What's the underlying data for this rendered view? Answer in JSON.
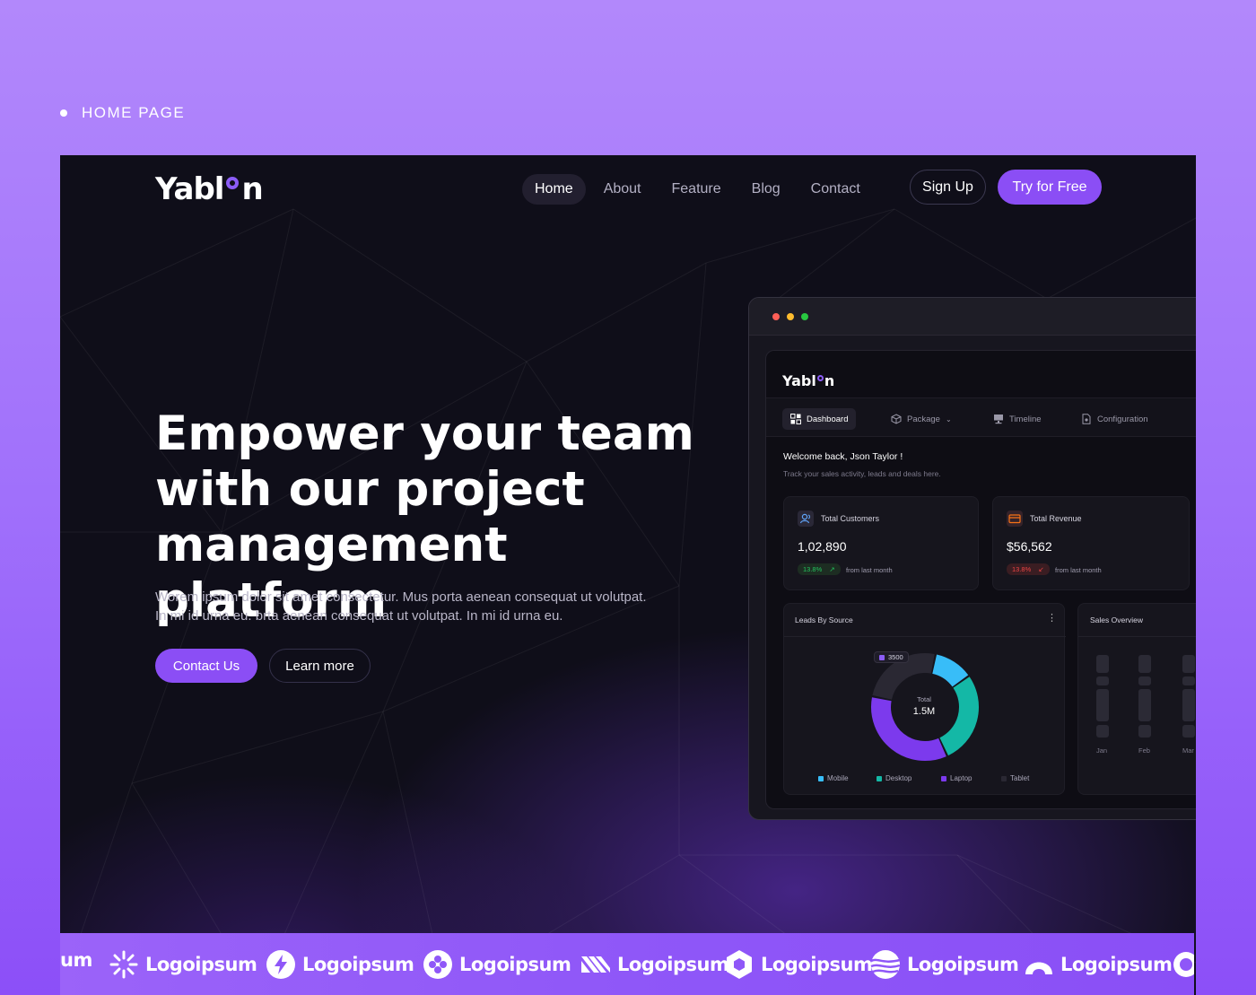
{
  "section_label": "HOME PAGE",
  "brand": {
    "logo_text_left": "Yabl",
    "logo_text_right": "n",
    "accent_color": "#8b4ef5"
  },
  "nav": {
    "items": [
      {
        "label": "Home",
        "active": true
      },
      {
        "label": "About"
      },
      {
        "label": "Feature"
      },
      {
        "label": "Blog"
      },
      {
        "label": "Contact"
      }
    ],
    "signup_label": "Sign Up",
    "try_label": "Try for Free"
  },
  "hero": {
    "title_line1": "Empower your team",
    "title_line2": "with our project",
    "title_line3": "management platform",
    "desc_line1": "Worem ipsum dolor sit amet consectetur. Mus porta aenean consequat ut volutpat.",
    "desc_line2": "In mi id urna eu. brta aenean consequat ut volutpat. In mi id urna eu.",
    "contact_label": "Contact Us",
    "learn_label": "Learn more"
  },
  "dashboard": {
    "traffic_lights": [
      "#ff5f57",
      "#febc2e",
      "#28c840"
    ],
    "tabs": [
      {
        "label": "Dashboard",
        "icon": "grid-icon",
        "active": true
      },
      {
        "label": "Package",
        "icon": "box-icon"
      },
      {
        "label": "Timeline",
        "icon": "monitor-icon"
      },
      {
        "label": "Configuration",
        "icon": "file-icon"
      }
    ],
    "welcome": "Welcome back, Json Taylor !",
    "welcome_sub": "Track your sales activity, leads and deals here.",
    "customers": {
      "title": "Total Customers",
      "value": "1,02,890",
      "change": "13.8%",
      "from": "from last month",
      "trend": "up",
      "color": "#22c55e"
    },
    "revenue": {
      "title": "Total Revenue",
      "value": "$56,562",
      "change": "13.8%",
      "from": "from last month",
      "trend": "down",
      "color": "#ef4444"
    },
    "leads": {
      "title": "Leads By Source",
      "badge": "3500",
      "center_label": "Total",
      "center_value": "1.5M",
      "legend": [
        {
          "name": "Mobile",
          "color": "#38bdf8"
        },
        {
          "name": "Desktop",
          "color": "#14b8a6"
        },
        {
          "name": "Laptop",
          "color": "#7c3aed"
        },
        {
          "name": "Tablet",
          "color": "#2a2833"
        }
      ]
    },
    "sales": {
      "title": "Sales Overview",
      "months": [
        "Jan",
        "Feb",
        "Mar"
      ]
    }
  },
  "chart_data": {
    "type": "pie",
    "title": "Leads By Source",
    "categories": [
      "Mobile",
      "Desktop",
      "Laptop",
      "Tablet"
    ],
    "values": [
      12,
      28,
      35,
      25
    ]
  },
  "logos": [
    {
      "label": "um",
      "icon": ""
    },
    {
      "label": "Logoipsum",
      "icon": "sunburst-icon"
    },
    {
      "label": "Logoipsum",
      "icon": "bolt-icon"
    },
    {
      "label": "Logoipsum",
      "icon": "clover-icon"
    },
    {
      "label": "Logoipsum",
      "icon": "stripes-icon"
    },
    {
      "label": "Logoipsum",
      "icon": "hexagon-icon"
    },
    {
      "label": "Logoipsum",
      "icon": "wave-globe-icon"
    },
    {
      "label": "Logoipsum",
      "icon": "arch-icon"
    },
    {
      "label": "",
      "icon": "gear-icon"
    }
  ]
}
